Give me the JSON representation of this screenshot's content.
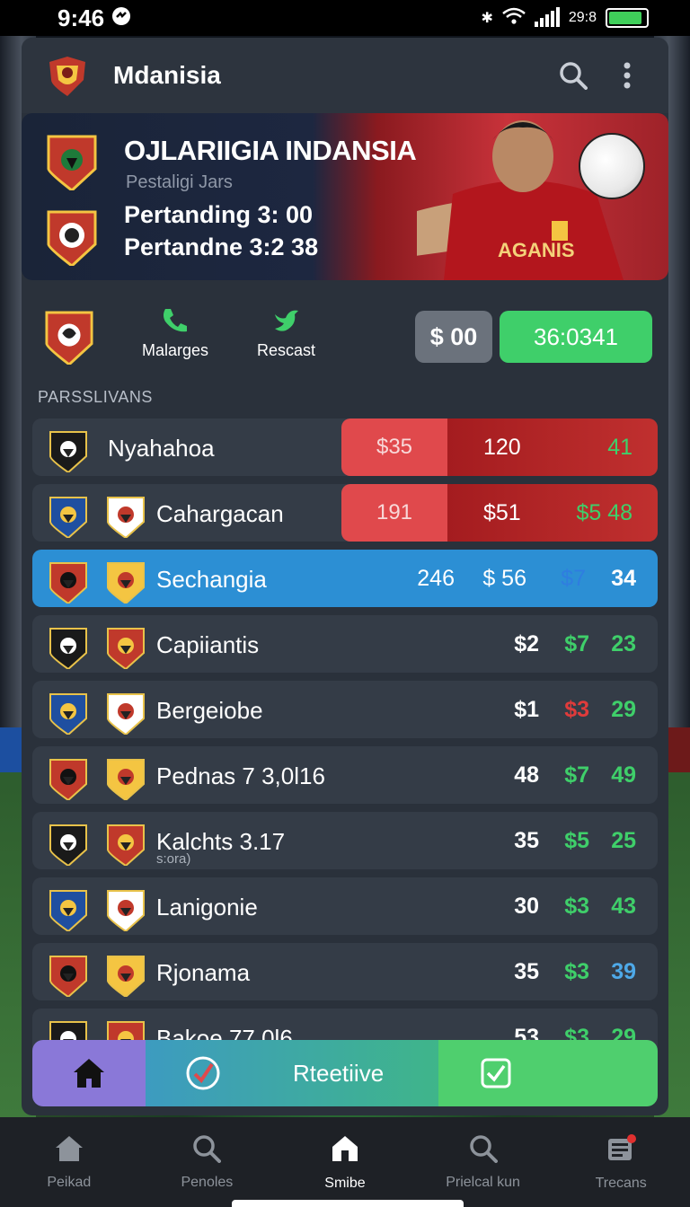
{
  "status": {
    "time": "9:46",
    "battery_text": "29:8",
    "battery_level": 0.9
  },
  "app": {
    "title": "Mdanisia"
  },
  "hero": {
    "title": "OJLARIIGIA INDANSIA",
    "subtitle": "Pestaligi Jars",
    "line1": "Pertanding 3: 00",
    "line2": "Pertandne 3:2 38",
    "jersey_text": "AGANIS"
  },
  "quick": {
    "items": [
      {
        "label": "Malarges",
        "icon": "phone-icon"
      },
      {
        "label": "Rescast",
        "icon": "bird-icon"
      }
    ],
    "pill_gray": "$ 00",
    "pill_green": "36:0341"
  },
  "section_title": "PARSSLIVANS",
  "rows": [
    {
      "name": "Nyahahoa",
      "sub": "",
      "odds": [
        "$35",
        "120",
        "41"
      ],
      "style": "red",
      "crests": 1
    },
    {
      "name": "Cahargacan",
      "sub": "",
      "odds": [
        "191",
        "$51",
        "$5 48"
      ],
      "style": "red",
      "crests": 2
    },
    {
      "name": "Sechangia",
      "sub": "",
      "v1": "246",
      "v2a": "$ 56",
      "v2b": "$7",
      "v3": "34",
      "style": "highlight"
    },
    {
      "name": "Capiiantis",
      "sub": "",
      "v1": "$2",
      "v2": "$7",
      "v3": "23",
      "v2c": "green",
      "v3c": "green"
    },
    {
      "name": "Bergeiobe",
      "sub": "",
      "v1": "$1",
      "v2": "$3",
      "v3": "29",
      "v2c": "red",
      "v3c": "green"
    },
    {
      "name": "Pednas 7 3,0l16",
      "sub": "",
      "v1": "48",
      "v2": "$7",
      "v3": "49",
      "v2c": "green",
      "v3c": "green"
    },
    {
      "name": "Kalchts 3.17",
      "sub": "s:ora)",
      "v1": "35",
      "v2": "$5",
      "v3": "25",
      "v2c": "green",
      "v3c": "green"
    },
    {
      "name": "Lanigonie",
      "sub": "",
      "v1": "30",
      "v2": "$3",
      "v3": "43",
      "v2c": "green",
      "v3c": "green"
    },
    {
      "name": "Rjonama",
      "sub": "",
      "v1": "35",
      "v2": "$3",
      "v3": "39",
      "v2c": "green",
      "v3c": "teal"
    },
    {
      "name": "Bakoe 77 0l6",
      "sub": "",
      "v1": "53",
      "v2": "$3",
      "v3": "29",
      "v2c": "green",
      "v3c": "green"
    }
  ],
  "fab": {
    "label": "Rteetiive"
  },
  "bottom_nav": [
    {
      "label": "Peikad",
      "icon": "home-icon"
    },
    {
      "label": "Penoles",
      "icon": "search-icon"
    },
    {
      "label": "Smibe",
      "icon": "home-outline-icon",
      "active": true
    },
    {
      "label": "Prielcal kun",
      "icon": "search-icon"
    },
    {
      "label": "Trecans",
      "icon": "news-icon"
    }
  ],
  "colors": {
    "accent_green": "#3fcf6a",
    "accent_red": "#e0494c",
    "accent_blue": "#2c8fd4",
    "panel": "#2a313b"
  }
}
